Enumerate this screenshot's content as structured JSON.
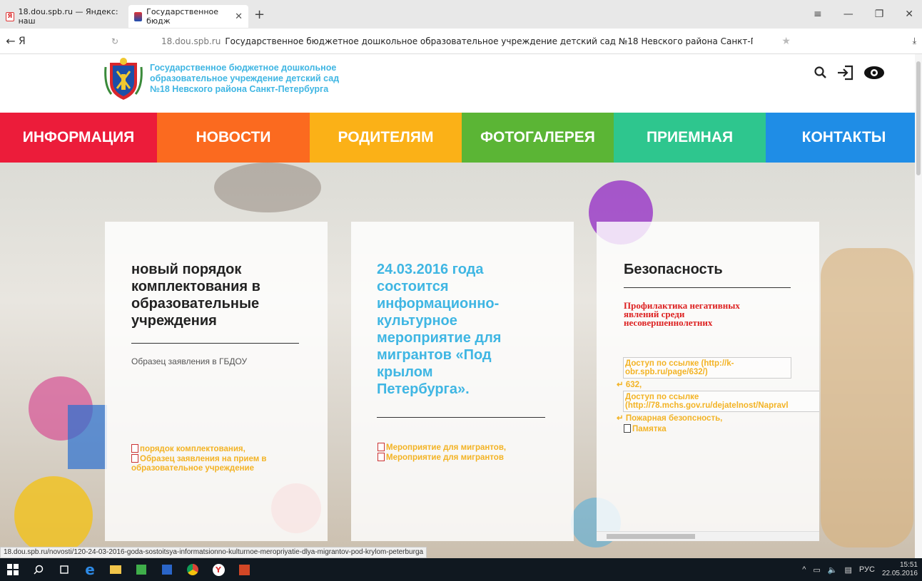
{
  "browser": {
    "tabs": [
      {
        "title": "18.dou.spb.ru — Яндекс: наш",
        "active": false
      },
      {
        "title": "Государственное бюдж",
        "active": true
      }
    ],
    "newtab": "+",
    "address": {
      "ya": "Я",
      "domain": "18.dou.spb.ru",
      "title": "Государственное бюджетное дошкольное образовательное учреждение детский сад №18 Невского района Санкт-Петербурга - Детск..."
    },
    "status_url": "18.dou.spb.ru/novosti/120-24-03-2016-goda-sostoitsya-informatsionno-kulturnoe-meropriyatie-dlya-migrantov-pod-krylom-peterburga"
  },
  "site": {
    "org_name_lines": [
      "Государственное бюджетное дошкольное",
      "образовательное учреждение детский сад",
      "№18 Невского района Санкт-Петербурга"
    ],
    "nav": [
      {
        "label": "ИНФОРМАЦИЯ",
        "color": "#ec1c3a"
      },
      {
        "label": "НОВОСТИ",
        "color": "#fb6a1f"
      },
      {
        "label": "РОДИТЕЛЯМ",
        "color": "#fbb117"
      },
      {
        "label": "ФОТОГАЛЕРЕЯ",
        "color": "#5bb535"
      },
      {
        "label": "ПРИЕМНАЯ",
        "color": "#2ec68e"
      },
      {
        "label": "КОНТАКТЫ",
        "color": "#1f8de6"
      }
    ],
    "cards": {
      "card1": {
        "title_lines": [
          "новый порядок",
          "комплектования в",
          "образовательные",
          "учреждения"
        ],
        "desc": "Образец заявления в ГБДОУ",
        "link1": "порядок комплектования,",
        "link2a": "Образец заявления на прием в",
        "link2b": "образовательное учреждение"
      },
      "card2": {
        "title_lines": [
          "24.03.2016 года",
          "состоится",
          "информационно-",
          "культурное",
          "мероприятие для",
          "мигрантов «Под",
          "крылом",
          "Петербурга»."
        ],
        "link1": "Мероприятие для мигрантов,",
        "link2": "Мероприятие для мигрантов"
      },
      "card3": {
        "title": "Безопасность",
        "red_lines": [
          "Профилактика негативных",
          "явлений среди",
          "несовершеннолетних"
        ],
        "box1a": "Доступ по ссылке (http://k-",
        "box1b": "obr.spb.ru/page/632/)",
        "link632": "632,",
        "box2a": "Доступ по ссылке",
        "box2b": "(http://78.mchs.gov.ru/dejatelnost/Napravl",
        "link_fire": "Пожарная безопсность,",
        "link_memo": "Памятка"
      }
    }
  },
  "taskbar": {
    "lang": "РУС",
    "time": "15:51",
    "date": "22.05.2016"
  }
}
